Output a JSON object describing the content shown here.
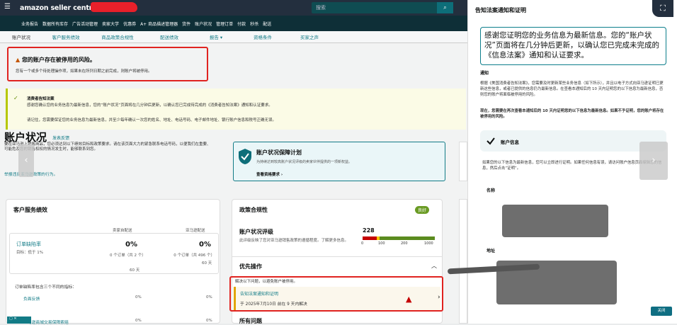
{
  "header": {
    "logo": "amazon seller central",
    "search_placeholder": "搜索",
    "search_icon": "search-icon"
  },
  "nav": {
    "items": [
      "业务报告",
      "数据所有库存",
      "广告活动管理",
      "卖家大学",
      "优惠券",
      "A+ 商品描述管理器",
      "货件",
      "账户状况",
      "管理订单",
      "付款",
      "秒杀",
      "配送"
    ]
  },
  "subnav": {
    "items": [
      "账户状况",
      "客户服务绩效",
      "商品政策合规性",
      "配送绩效",
      "报告 ▾",
      "资格条件",
      "买家之声"
    ]
  },
  "warning": {
    "title": "您的账户存在被停用的风险。",
    "text": "您有一个或多个待处理操作项，如果未在所列日期之前完成，则账户将被停用。"
  },
  "notice": {
    "title": "消费者告知法案",
    "p1": "感谢您确认您的业务信息为最新信息，您的“账户状况”页面将在几分钟后更新，以确认您已完成待完成的《消费者告知法案》通知和认证要求。",
    "p2": "请记住，您需要保证您的业务信息为最新信息，并至少每年确认一次您的姓名、地址、电话号码、电子邮件地址、银行账户信息和税号正确无误。"
  },
  "account": {
    "title": "账户状况",
    "feedback": "发表反馈",
    "desc": "要在亚马逊上销售商品，您必须达到以下绩效目标和政策要求。请在该页面大力的紧急联系电话号码，以便我们在重要、可能危及您的销售权权的情况发生时，能够联系到您。",
    "link": "举报违反亚马逊政策的行为。"
  },
  "plan": {
    "title": "账户状况保障计划",
    "desc": "为持续达到较高账户状况评级的卖家伙伴提供的一项新权益。",
    "link": "查看资格要求 ›"
  },
  "csp": {
    "title": "客户服务绩效",
    "col1": "卖家自配送",
    "col2": "亚马逊配送",
    "metric": "订单缺陷率",
    "target": "目标：低于 1%",
    "v1": "0%",
    "v1sub": "0 个订单（共 2 个）",
    "v1days": "60 天",
    "v2": "0%",
    "v2sub": "0 个订单（共 496 个）",
    "v2days": "60 天",
    "odr_note": "订单缺陷率包含三个不同的指标：",
    "neg": "负面反馈",
    "neg_v1": "0%",
    "neg_v2": "0%",
    "claims": "亚马逊商城交易保障索赔",
    "claims_v1": "0%",
    "claims_v2": "0%"
  },
  "policy": {
    "title": "政策合规性",
    "badge": "良好",
    "rating_title": "账户状况评级",
    "rating_val": "228",
    "rating_desc": "此评级反映了您对亚马逊销售政策的遵循程度。了解更多信息。",
    "scale": [
      "0",
      "100",
      "200",
      "1000"
    ],
    "priority": "优先操作",
    "priority_note": "解决以下问题，以避免账户被停用。",
    "item_title": "告知法案通知和证明",
    "item_date": "于 2025年7月10日 前在 9 天内解决",
    "all_issues": "所有问题"
  },
  "panel": {
    "title": "告知法案通知和证明",
    "banner": "感谢您证明您的业务信息为最新信息。您的“账户状况”页面将在几分钟后更新，以确认您已完成未完成的《信息法案》通知和认证要求。",
    "notice_title": "通知",
    "notice_p": "根据《美国消费者告知法案》，您需要及时更新某些业务信息（如下所示），并且以电子方式向亚马逊证明已更新这些信息，或者已提供的信息仍为最新信息。在查看本通知后的 10 天内证明您的以下信息为最新信息，否则您的账户将面临被停用的风险。",
    "notice_p2": "现在，您需要在再次查看本通知后的 10 天内证明您的以下信息为最新信息。如果不予证明，您的账户将存在被停用的风险。",
    "acct_info": "账户信息",
    "acct_desc": "如果您的以下信息为最新信息，您可以立即进行证明。如果任何信息有误，请访问账户信息页面编辑您的信息，然后点击“证明”。",
    "name_label": "名称",
    "addr_label": "地址",
    "close": "关闭"
  },
  "colors": {
    "accent": "#127b86",
    "warning_red": "#e02320",
    "dark_header": "#232f3e"
  }
}
